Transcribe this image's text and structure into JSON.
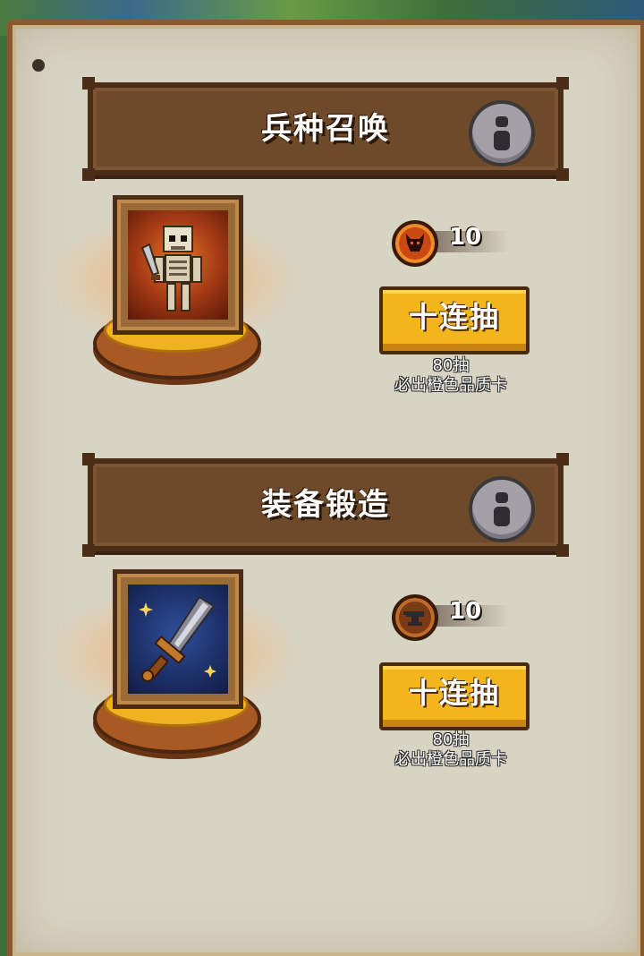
{
  "sections": [
    {
      "title": "兵种召唤",
      "card_art": "skeleton-warrior",
      "cost_icon": "demon-token-icon",
      "cost": "10",
      "draw_label": "十连抽",
      "note_line1": "80抽",
      "note_line2": "必出橙色品质卡"
    },
    {
      "title": "装备锻造",
      "card_art": "sword",
      "cost_icon": "anvil-token-icon",
      "cost": "10",
      "draw_label": "十连抽",
      "note_line1": "80抽",
      "note_line2": "必出橙色品质卡"
    }
  ],
  "colors": {
    "parchment": "#d8d4c4",
    "header_brown": "#6e4a2b",
    "button_gold": "#f2b51c",
    "pedestal_gold": "#f0b222"
  }
}
